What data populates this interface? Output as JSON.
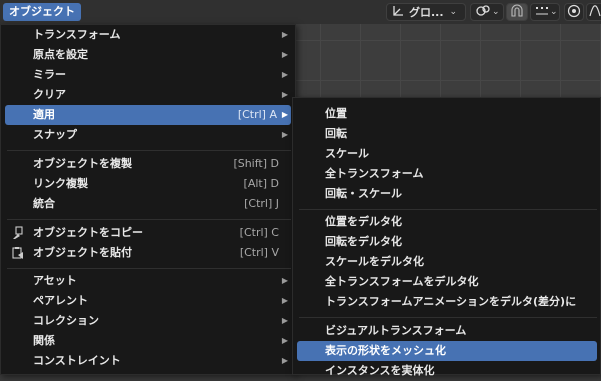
{
  "header": {
    "object_menu": "オブジェクト",
    "transform_orientation": "グロ...",
    "chevron": "⌄"
  },
  "menu": {
    "items": [
      {
        "label": "トランスフォーム",
        "shortcut": "",
        "submenu": true
      },
      {
        "label": "原点を設定",
        "shortcut": "",
        "submenu": true
      },
      {
        "label": "ミラー",
        "shortcut": "",
        "submenu": true
      },
      {
        "label": "クリア",
        "shortcut": "",
        "submenu": true
      },
      {
        "label": "適用",
        "shortcut": "[Ctrl] A",
        "submenu": true
      },
      {
        "label": "スナップ",
        "shortcut": "",
        "submenu": true
      },
      {
        "label": "オブジェクトを複製",
        "shortcut": "[Shift] D",
        "submenu": false
      },
      {
        "label": "リンク複製",
        "shortcut": "[Alt] D",
        "submenu": false
      },
      {
        "label": "統合",
        "shortcut": "[Ctrl] J",
        "submenu": false
      },
      {
        "label": "オブジェクトをコピー",
        "shortcut": "[Ctrl] C",
        "submenu": false
      },
      {
        "label": "オブジェクトを貼付",
        "shortcut": "[Ctrl] V",
        "submenu": false
      },
      {
        "label": "アセット",
        "shortcut": "",
        "submenu": true
      },
      {
        "label": "ペアレント",
        "shortcut": "",
        "submenu": true
      },
      {
        "label": "コレクション",
        "shortcut": "",
        "submenu": true
      },
      {
        "label": "関係",
        "shortcut": "",
        "submenu": true
      },
      {
        "label": "コンストレイント",
        "shortcut": "",
        "submenu": true
      }
    ],
    "arrow": "▶"
  },
  "submenu": {
    "items": [
      "位置",
      "回転",
      "スケール",
      "全トランスフォーム",
      "回転・スケール",
      "位置をデルタ化",
      "回転をデルタ化",
      "スケールをデルタ化",
      "全トランスフォームをデルタ化",
      "トランスフォームアニメーションをデルタ(差分)に",
      "ビジュアルトランスフォーム",
      "表示の形状をメッシュ化",
      "インスタンスを実体化"
    ]
  },
  "colors": {
    "accent": "#4772b3",
    "menu_bg": "#181818",
    "header_bg": "#303030"
  }
}
